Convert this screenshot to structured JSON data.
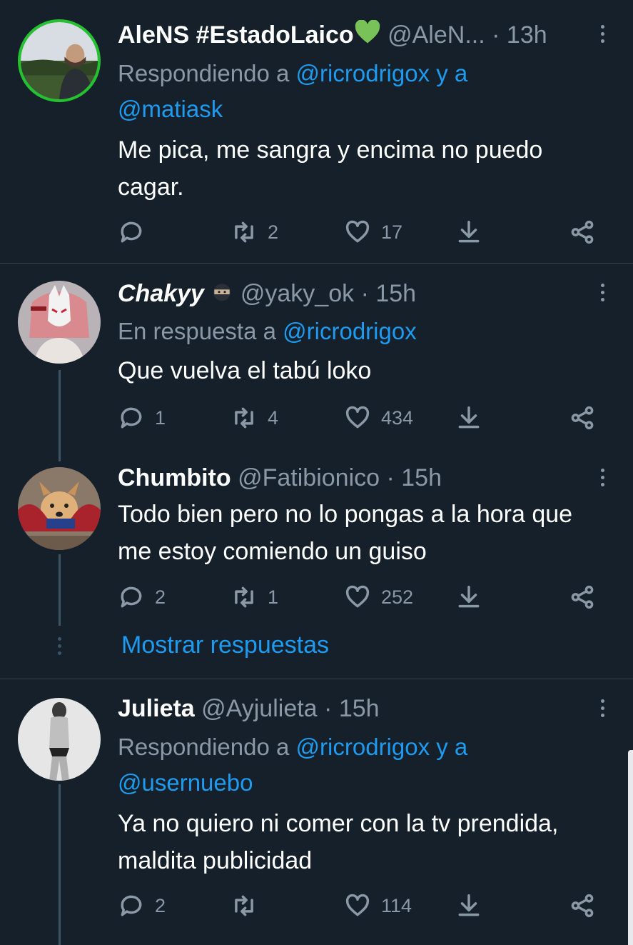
{
  "colors": {
    "background": "#15202b",
    "accent": "#1d9bf0",
    "muted": "#8b98a5",
    "divider": "#38444d"
  },
  "tweets": [
    {
      "name": "AleNS #EstadoLaico",
      "name_emoji": "green-heart",
      "handle": "@AleN...",
      "time": "13h",
      "reply_prefix": "Respondiendo a",
      "reply_mentions": "@ricrodrigox y a",
      "reply_mentions_2": "@matiask",
      "text_line1": "Me pica, me sangra y encima no puedo",
      "text_line2": "cagar.",
      "replies": "",
      "retweets": "2",
      "likes": "17"
    },
    {
      "name": "Chakyy",
      "name_emoji": "ninja",
      "handle": "@yaky_ok",
      "time": "15h",
      "reply_prefix": "En respuesta a",
      "reply_mentions": "@ricrodrigox",
      "text_line1": "Que vuelva el tabú loko",
      "replies": "1",
      "retweets": "4",
      "likes": "434"
    },
    {
      "name": "Chumbito",
      "handle": "@Fatibionico",
      "time": "15h",
      "text_line1": "Todo bien pero no lo pongas a la hora que",
      "text_line2": "me estoy comiendo un guiso",
      "replies": "2",
      "retweets": "1",
      "likes": "252"
    },
    {
      "name": "Julieta",
      "handle": "@Ayjulieta",
      "time": "15h",
      "reply_prefix": "Respondiendo a",
      "reply_mentions": "@ricrodrigox y a",
      "reply_mentions_2": "@usernuebo",
      "text_line1": "Ya no quiero ni comer con la tv prendida,",
      "text_line2": "maldita publicidad",
      "replies": "2",
      "retweets": "",
      "likes": "114"
    }
  ],
  "show_replies": "Mostrar respuestas",
  "dot": "·",
  "icons": [
    "reply-icon",
    "retweet-icon",
    "like-icon",
    "download-icon",
    "share-icon",
    "more-icon"
  ]
}
